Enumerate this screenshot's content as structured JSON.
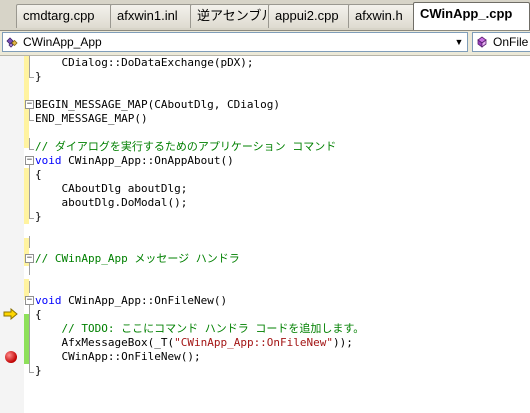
{
  "tabs": [
    {
      "label": "cmdtarg.cpp",
      "active": false
    },
    {
      "label": "afxwin1.inl",
      "active": false
    },
    {
      "label": "逆アセンブル",
      "active": false
    },
    {
      "label": "appui2.cpp",
      "active": false
    },
    {
      "label": "afxwin.h",
      "active": false
    },
    {
      "label": "CWinApp_.cpp",
      "active": true
    }
  ],
  "nav": {
    "class_combo": "CWinApp_App",
    "member_combo": "OnFile"
  },
  "code": {
    "line_dodataexchange": "CDialog::DoDataExchange(pDX);",
    "line_close1": "}",
    "line_begin_map": "BEGIN_MESSAGE_MAP(CAboutDlg, CDialog)",
    "line_end_map": "END_MESSAGE_MAP()",
    "comment_run_about": "// ダイアログを実行するためのアプリケーション コマンド",
    "kw_void1": "void",
    "line_onappabout": " CWinApp_App::OnAppAbout()",
    "line_open2": "{",
    "line_aboutdlg": "CAboutDlg aboutDlg;",
    "line_domodal": "aboutDlg.DoModal();",
    "line_close2": "}",
    "comment_handlers": "// CWinApp_App メッセージ ハンドラ",
    "kw_void2": "void",
    "line_onfilenew": " CWinApp_App::OnFileNew()",
    "line_open3": "{",
    "comment_todo": "// TODO: ここにコマンド ハンドラ コードを追加します。",
    "line_msgbox_pre": "AfxMessageBox(_T(",
    "line_msgbox_str": "\"CWinApp_App::OnFileNew\"",
    "line_msgbox_post": "));",
    "line_base_onfilenew": "CWinApp::OnFileNew();",
    "line_close3": "}"
  },
  "colors": {
    "keyword": "#0000ff",
    "comment": "#008000",
    "string": "#a31515",
    "breakpoint": "#c00000",
    "current_line_arrow": "#ffd700"
  },
  "icons": {
    "class_combo_icon": "class-icon",
    "member_combo_icon": "method-icon",
    "margin_arrow": "next-statement-arrow-icon",
    "margin_dot": "breakpoint-icon"
  }
}
